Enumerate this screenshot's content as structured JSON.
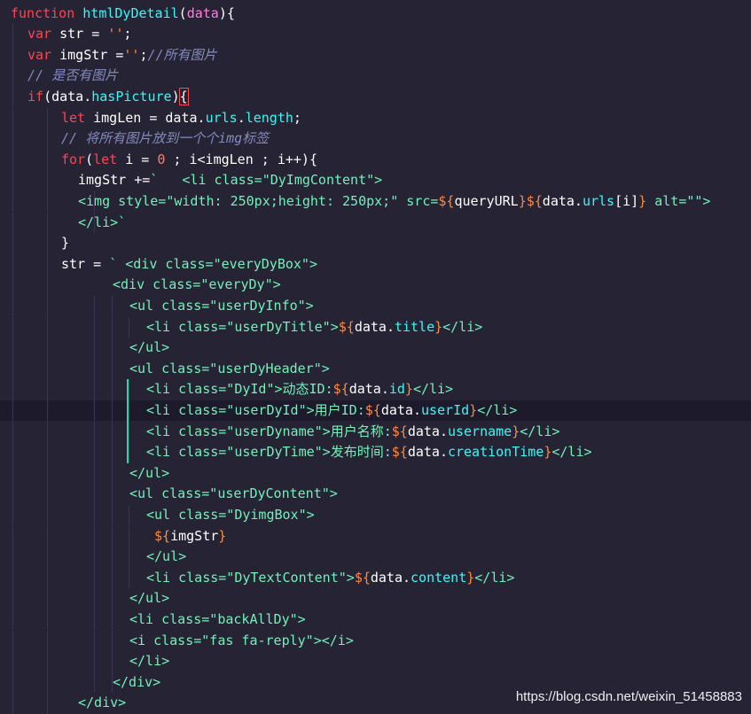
{
  "editor": {
    "lines": [
      {
        "indent": 0,
        "tokens": [
          [
            "function ",
            "kw2"
          ],
          [
            "htmlDyDetail",
            "fn"
          ],
          [
            "(",
            "pl"
          ],
          [
            "data",
            "var"
          ],
          [
            "){",
            "pl"
          ]
        ]
      },
      {
        "indent": 1,
        "tokens": [
          [
            "var ",
            "kw2"
          ],
          [
            "str = ",
            "pl"
          ],
          [
            "''",
            "str"
          ],
          [
            ";",
            "pl"
          ]
        ]
      },
      {
        "indent": 1,
        "tokens": [
          [
            "var ",
            "kw2"
          ],
          [
            "imgStr =",
            "pl"
          ],
          [
            "''",
            "str"
          ],
          [
            ";",
            "pl"
          ],
          [
            "//所有图片",
            "cmt"
          ]
        ]
      },
      {
        "indent": 1,
        "tokens": [
          [
            "// 是否有图片",
            "cmt"
          ]
        ]
      },
      {
        "indent": 1,
        "tokens": [
          [
            "if",
            "kw2"
          ],
          [
            "(",
            "pl"
          ],
          [
            "data",
            "pl"
          ],
          [
            ".",
            "pl"
          ],
          [
            "hasPicture",
            "fn"
          ],
          [
            ")",
            "pl"
          ],
          [
            "{",
            "bracket"
          ]
        ]
      },
      {
        "indent": 2,
        "tokens": [
          [
            "let ",
            "kw2"
          ],
          [
            "imgLen = ",
            "pl"
          ],
          [
            "data",
            "pl"
          ],
          [
            ".",
            "pl"
          ],
          [
            "urls",
            "fn"
          ],
          [
            ".",
            "pl"
          ],
          [
            "length",
            "fn"
          ],
          [
            ";",
            "pl"
          ]
        ]
      },
      {
        "indent": 2,
        "tokens": [
          [
            "// 将所有图片放到一个个img标签",
            "cmt"
          ]
        ]
      },
      {
        "indent": 2,
        "tokens": [
          [
            "for",
            "kw2"
          ],
          [
            "(",
            "pl"
          ],
          [
            "let ",
            "kw2"
          ],
          [
            "i = ",
            "pl"
          ],
          [
            "0",
            "num"
          ],
          [
            " ; i<imgLen ; i++){",
            "pl"
          ]
        ]
      },
      {
        "indent": 3,
        "tokens": [
          [
            "imgStr +=",
            "pl"
          ],
          [
            "`   <li class=\"DyImgContent\">",
            "tpl"
          ]
        ]
      },
      {
        "indent": 3,
        "tokens": [
          [
            "<img style=\"width: 250px;height: 250px;\" src=",
            "tpl"
          ],
          [
            "${",
            "str"
          ],
          [
            "queryURL",
            "pl"
          ],
          [
            "}",
            "str"
          ],
          [
            "${",
            "str"
          ],
          [
            "data",
            "pl"
          ],
          [
            ".",
            "pl"
          ],
          [
            "urls",
            "fn"
          ],
          [
            "[i]",
            "pl"
          ],
          [
            "}",
            "str"
          ],
          [
            " alt=\"\">",
            "tpl"
          ]
        ]
      },
      {
        "indent": 3,
        "tokens": [
          [
            "</li>`",
            "tpl"
          ]
        ]
      },
      {
        "indent": 2,
        "tokens": [
          [
            "}",
            "pl"
          ]
        ]
      },
      {
        "indent": 2,
        "tokens": [
          [
            "str = ",
            "pl"
          ],
          [
            "` <div class=\"everyDyBox\">",
            "tpl"
          ]
        ]
      },
      {
        "indent": 4,
        "tokens": [
          [
            "<div class=\"everyDy\">",
            "tpl"
          ]
        ]
      },
      {
        "indent": 5,
        "tokens": [
          [
            "<ul class=\"userDyInfo\">",
            "tpl"
          ]
        ]
      },
      {
        "indent": 6,
        "tokens": [
          [
            "<li class=\"userDyTitle\">",
            "tpl"
          ],
          [
            "${",
            "str"
          ],
          [
            "data",
            "pl"
          ],
          [
            ".",
            "pl"
          ],
          [
            "title",
            "fn"
          ],
          [
            "}",
            "str"
          ],
          [
            "</li>",
            "tpl"
          ]
        ]
      },
      {
        "indent": 5,
        "tokens": [
          [
            "</ul>",
            "tpl"
          ]
        ]
      },
      {
        "indent": 5,
        "tokens": [
          [
            "<ul class=\"userDyHeader\">",
            "tpl"
          ]
        ]
      },
      {
        "indent": 6,
        "tokens": [
          [
            "<li class=\"DyId\">动态ID:",
            "tpl"
          ],
          [
            "${",
            "str"
          ],
          [
            "data",
            "pl"
          ],
          [
            ".",
            "pl"
          ],
          [
            "id",
            "fn"
          ],
          [
            "}",
            "str"
          ],
          [
            "</li>",
            "tpl"
          ]
        ]
      },
      {
        "indent": 6,
        "tokens": [
          [
            "<li class=\"userDyId\">用户ID:",
            "tpl"
          ],
          [
            "${",
            "str"
          ],
          [
            "data",
            "pl"
          ],
          [
            ".",
            "pl"
          ],
          [
            "userId",
            "fn"
          ],
          [
            "}",
            "str"
          ],
          [
            "</li>",
            "tpl"
          ]
        ]
      },
      {
        "indent": 6,
        "tokens": [
          [
            "<li class=\"userDyname\">用户名称:",
            "tpl"
          ],
          [
            "${",
            "str"
          ],
          [
            "data",
            "pl"
          ],
          [
            ".",
            "pl"
          ],
          [
            "username",
            "fn"
          ],
          [
            "}",
            "str"
          ],
          [
            "</li>",
            "tpl"
          ]
        ]
      },
      {
        "indent": 6,
        "tokens": [
          [
            "<li class=\"userDyTime\">发布时间:",
            "tpl"
          ],
          [
            "${",
            "str"
          ],
          [
            "data",
            "pl"
          ],
          [
            ".",
            "pl"
          ],
          [
            "creationTime",
            "fn"
          ],
          [
            "}",
            "str"
          ],
          [
            "</li>",
            "tpl"
          ]
        ]
      },
      {
        "indent": 5,
        "tokens": [
          [
            "</ul>",
            "tpl"
          ]
        ]
      },
      {
        "indent": 5,
        "tokens": [
          [
            "<ul class=\"userDyContent\">",
            "tpl"
          ]
        ]
      },
      {
        "indent": 6,
        "tokens": [
          [
            "<ul class=\"DyimgBox\">",
            "tpl"
          ]
        ]
      },
      {
        "indent": 6,
        "tokens": [
          [
            " ",
            "pl"
          ],
          [
            "${",
            "str"
          ],
          [
            "imgStr",
            "pl"
          ],
          [
            "}",
            "str"
          ]
        ]
      },
      {
        "indent": 6,
        "tokens": [
          [
            "</ul>",
            "tpl"
          ]
        ]
      },
      {
        "indent": 6,
        "tokens": [
          [
            "<li class=\"DyTextContent\">",
            "tpl"
          ],
          [
            "${",
            "str"
          ],
          [
            "data",
            "pl"
          ],
          [
            ".",
            "pl"
          ],
          [
            "content",
            "fn"
          ],
          [
            "}",
            "str"
          ],
          [
            "</li>",
            "tpl"
          ]
        ]
      },
      {
        "indent": 5,
        "tokens": [
          [
            "</ul>",
            "tpl"
          ]
        ]
      },
      {
        "indent": 5,
        "tokens": [
          [
            "<li class=\"backAllDy\">",
            "tpl"
          ]
        ]
      },
      {
        "indent": 5,
        "tokens": [
          [
            "<i class=\"fas fa-reply\"></i>",
            "tpl"
          ]
        ]
      },
      {
        "indent": 5,
        "tokens": [
          [
            "</li>",
            "tpl"
          ]
        ]
      },
      {
        "indent": 4,
        "tokens": [
          [
            "</div>",
            "tpl"
          ]
        ]
      },
      {
        "indent": 3,
        "tokens": [
          [
            "</div>",
            "tpl"
          ]
        ]
      }
    ],
    "current_line": 19,
    "watermark": "https://blog.csdn.net/weixin_51458883"
  }
}
